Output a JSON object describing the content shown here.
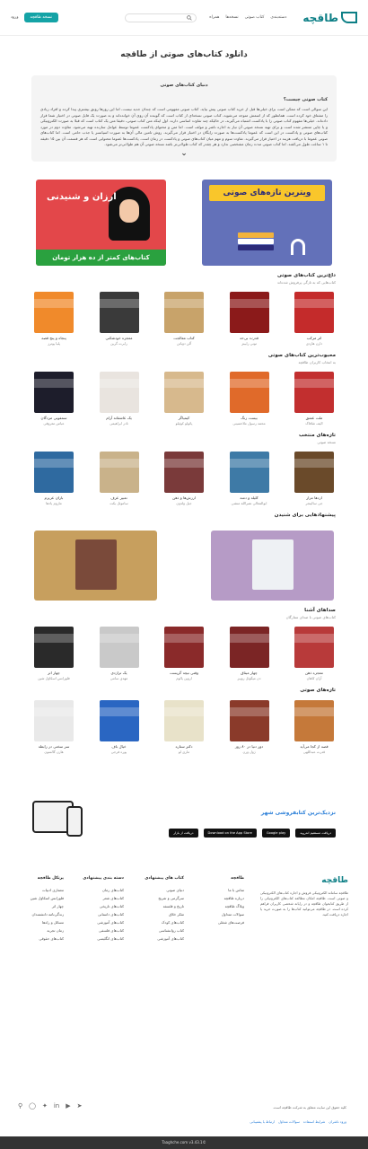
{
  "header": {
    "logo_text": "طاقچه",
    "nav": [
      "دسته‌بندی",
      "کتاب صوتی",
      "نسخه‌ها",
      "همراه"
    ],
    "search_placeholder": "",
    "cta_label": "نسخه طاقچه",
    "login_label": "ورود"
  },
  "page": {
    "title": "دانلود کتاب‌های صوتی از طاقچه"
  },
  "intro": {
    "heading": "دنیای کتاب‌های صوتی",
    "question": "کتاب صوتی چیست؟",
    "body": "این سوالی است که ممکن است برای خیلی‌ها قبل از خرید کتاب صوتی پیش بیاید. کتاب صوتی مفهومی است که چندان جدید نیست، اما این روزها رونق بیشتری پیدا کرده و افراد زیادی را مشتاق خود کرده است. همانطور که از اسمش متوجه می‌شوید، کتاب صوتی نسخه‌ای از کتاب است که گوینده آن روی آن خوانده‌اند و به صورت یک فایل صوتی در اختیار شما قرار داده‌اند. خیلی‌ها مفهوم کتاب صوتی را با پادکست اشتباه می‌گیرند، در حالیکه چند تفاوت اساسی دارند. اول اینکه متن کتاب صوتی، دقیقا متن یک کتاب است که قبلا به صورت الکترونیکی و یا چاپی منتشر شده است و برای تهیه نسخه صوتی آن نیاز به اجازه ناشر و مولف است. اما متن و محتوای پادکست عموما توسط عوامل سازنده تهیه می‌شود. تفاوت دوم در مورد کتاب‌های صوتی و پادکست در این است که عموما پادکست‌ها به صورت رایگان در اختیار قرار می‌گیرند. روش تامین مالی آن‌ها به صورت اسپانسر یا جذب حامی است. اما کتاب‌های صوتی عموما با دریافت هزینه در اختیار قرار می‌گیرند. تفاوت سوم و مهم میان کتاب‌های صوتی و پادکست در زمان است. پادکست‌ها عموما محتوایی است که هر قسمت آن بین ۱۵ دقیقه تا ۱ ساعت طول می‌کشد. اما کتاب صوتی مدت زمان مشخصی ندارد و هر چقدر که کتاب طولانی‌تر باشد نسخه صوتی آن هم طولانی‌تر می‌شود."
  },
  "banners": {
    "left": {
      "title": "ویترین تازه‌های صوتی"
    },
    "right": {
      "title": "ارزان و شنیدنی",
      "strip": "کتاب‌های کمتر از ده هزار تومان"
    }
  },
  "sections": [
    {
      "title": "داغ‌ترین کتاب‌های صوتی",
      "subtitle": "کتاب‌هایی که به تازگی پرفروش شده‌اند",
      "items": [
        {
          "title": "اثر مرکب",
          "author": "دارن هاردی",
          "color": "#c42b2b"
        },
        {
          "title": "قدرت بی‌حد",
          "author": "تونی رابینز",
          "color": "#8b1a1a"
        },
        {
          "title": "کتاب معالجت",
          "author": "آلن دوباتن",
          "color": "#c8a36a"
        },
        {
          "title": "معجزه خودشکنی",
          "author": "رابرت گرین",
          "color": "#3a3a3a"
        },
        {
          "title": "پنجاه و پنج قصه",
          "author": "پلیا پوترز",
          "color": "#f08a2b"
        }
      ]
    },
    {
      "title": "محبوب‌ترین کتاب‌های صوتی",
      "subtitle": "به انتخاب کاربران طاقچه",
      "items": [
        {
          "title": "ملت عشق",
          "author": "الیف شافاک",
          "color": "#c22f2f"
        },
        {
          "title": "بیست زنگ",
          "author": "محمد رسول ملاحسینی",
          "color": "#e06a2a"
        },
        {
          "title": "کیمیاگر",
          "author": "پائولو کوئیلو",
          "color": "#d7b98d"
        },
        {
          "title": "یک عاشقانه آرام",
          "author": "نادر ابراهیمی",
          "color": "#e9e4df"
        },
        {
          "title": "سمفونی مردگان",
          "author": "عباس معروفی",
          "color": "#1d1d2b"
        }
      ]
    },
    {
      "title": "تازه‌های منتخب",
      "subtitle": "نسخه صوتی",
      "items": [
        {
          "title": "ازدها مزار",
          "author": "جی سالینجر",
          "color": "#6a4a2a"
        },
        {
          "title": "کلیله و دمنه",
          "author": "ابوالمعالی نصرالله منشی",
          "color": "#3e7aa6"
        },
        {
          "title": "ارزش‌ها و ذهن",
          "author": "جیل ولدون",
          "color": "#7a3a3a"
        },
        {
          "title": "تعبیر عرف",
          "author": "ساموئل بکت",
          "color": "#c9b28a"
        },
        {
          "title": "باران عزیزم",
          "author": "ماروم یادها",
          "color": "#2f6aa0"
        }
      ]
    },
    {
      "title": "صداهای آشنا",
      "subtitle": "کتاب‌های صوتی با صدای ستارگان",
      "items": [
        {
          "title": "معجزه ذهن",
          "author": "آران کاهان",
          "color": "#b83a3a"
        },
        {
          "title": "چهار میثاق",
          "author": "دن میگوئل روییز",
          "color": "#7b2525"
        },
        {
          "title": "وقتی نیچه گریست",
          "author": "اروین یالوم",
          "color": "#8a2a2a"
        },
        {
          "title": "یک تراژدی",
          "author": "مهدی سامی",
          "color": "#c9c9c9"
        },
        {
          "title": "چهار اثر",
          "author": "فلورانس اسکاول شین",
          "color": "#2a2a2a"
        }
      ]
    },
    {
      "title": "تازه‌های صوتی",
      "subtitle": "",
      "items": [
        {
          "title": "قصه از کجا می‌آید",
          "author": "قدرت عبداللهی",
          "color": "#c5793a"
        },
        {
          "title": "دور دنیا در ۸۰ روز",
          "author": "ژول ورن",
          "color": "#8a3a2a"
        },
        {
          "title": "دکتر ستاره",
          "author": "ماری لو",
          "color": "#e8e2c9"
        },
        {
          "title": "خیال باف",
          "author": "پوره فرجی",
          "color": "#2a66c2"
        },
        {
          "title": "سر سختی در رابطه",
          "author": "هارن گالسون",
          "color": "#e9e9e9"
        }
      ]
    }
  ],
  "suggestions": {
    "title": "پیشنهادهایی برای شنیدن"
  },
  "app": {
    "title": "نزدیک‌ترین کتابفروشی شهر",
    "stores": [
      "دریافت مستقیم اندروید",
      "Google play",
      "Download on the App Store",
      "دریافت از بازار"
    ]
  },
  "footer": {
    "about": "طاقچه سامانه الکترونیکی فروش و اجاره کتاب‌های الکترونیکی و صوتی است. طاقچه امکان مطالعه کتاب‌های الکترونیکی را از طریق کتابخوان طاقچه و در رایانه شخصی کاربران فراهم کرده است. در طاقچه می‌توانید کتاب‌ها را به صورت خرید یا اجاره دریافت کنید.",
    "cols": [
      {
        "title": "طاقچه",
        "items": [
          "تماس با ما",
          "درباره طاقچه",
          "وبلاگ طاقچه",
          "سوالات متداول",
          "فرصت‌های شغلی"
        ]
      },
      {
        "title": "کتاب های پیشنهادی",
        "items": [
          "دنیای صوتی",
          "سرگرمی و تفریح",
          "تاریخ و فلسفه",
          "تفکر خلاق",
          "کتاب‌های کودک",
          "کتاب روانشناسی",
          "کتاب‌های آموزشی"
        ]
      },
      {
        "title": "دسته بندی پیشنهادی",
        "items": [
          "کتاب‌های رمان",
          "کتاب‌های شعر",
          "کتاب‌های تاریخی",
          "کتاب‌های داستانی",
          "کتاب‌های آموزشی",
          "کتاب‌های فلسفی",
          "کتاب‌های انگلیسی"
        ]
      },
      {
        "title": "پرتکل طاقچه",
        "items": [
          "معماری ادبیات",
          "فلورانس اسکاول شین",
          "چهار اثر",
          "زندگی‌نامه دانشمندان",
          "مسائل و راه‌ها",
          "زمان تجربه",
          "کتاب‌های حقوقی"
        ]
      }
    ],
    "copyright": "کلیه حقوق این سایت متعلق به شرکت طاقچه است.",
    "links": [
      "ورود ناشران",
      "شرایط استفاده",
      "سوالات متداول",
      "ارتباط با پشتیبانی"
    ],
    "bottom": "©Taaghche.com v3.43.1"
  },
  "colors": {
    "accent": "#14a3a6",
    "brand": "#0d7f86"
  }
}
